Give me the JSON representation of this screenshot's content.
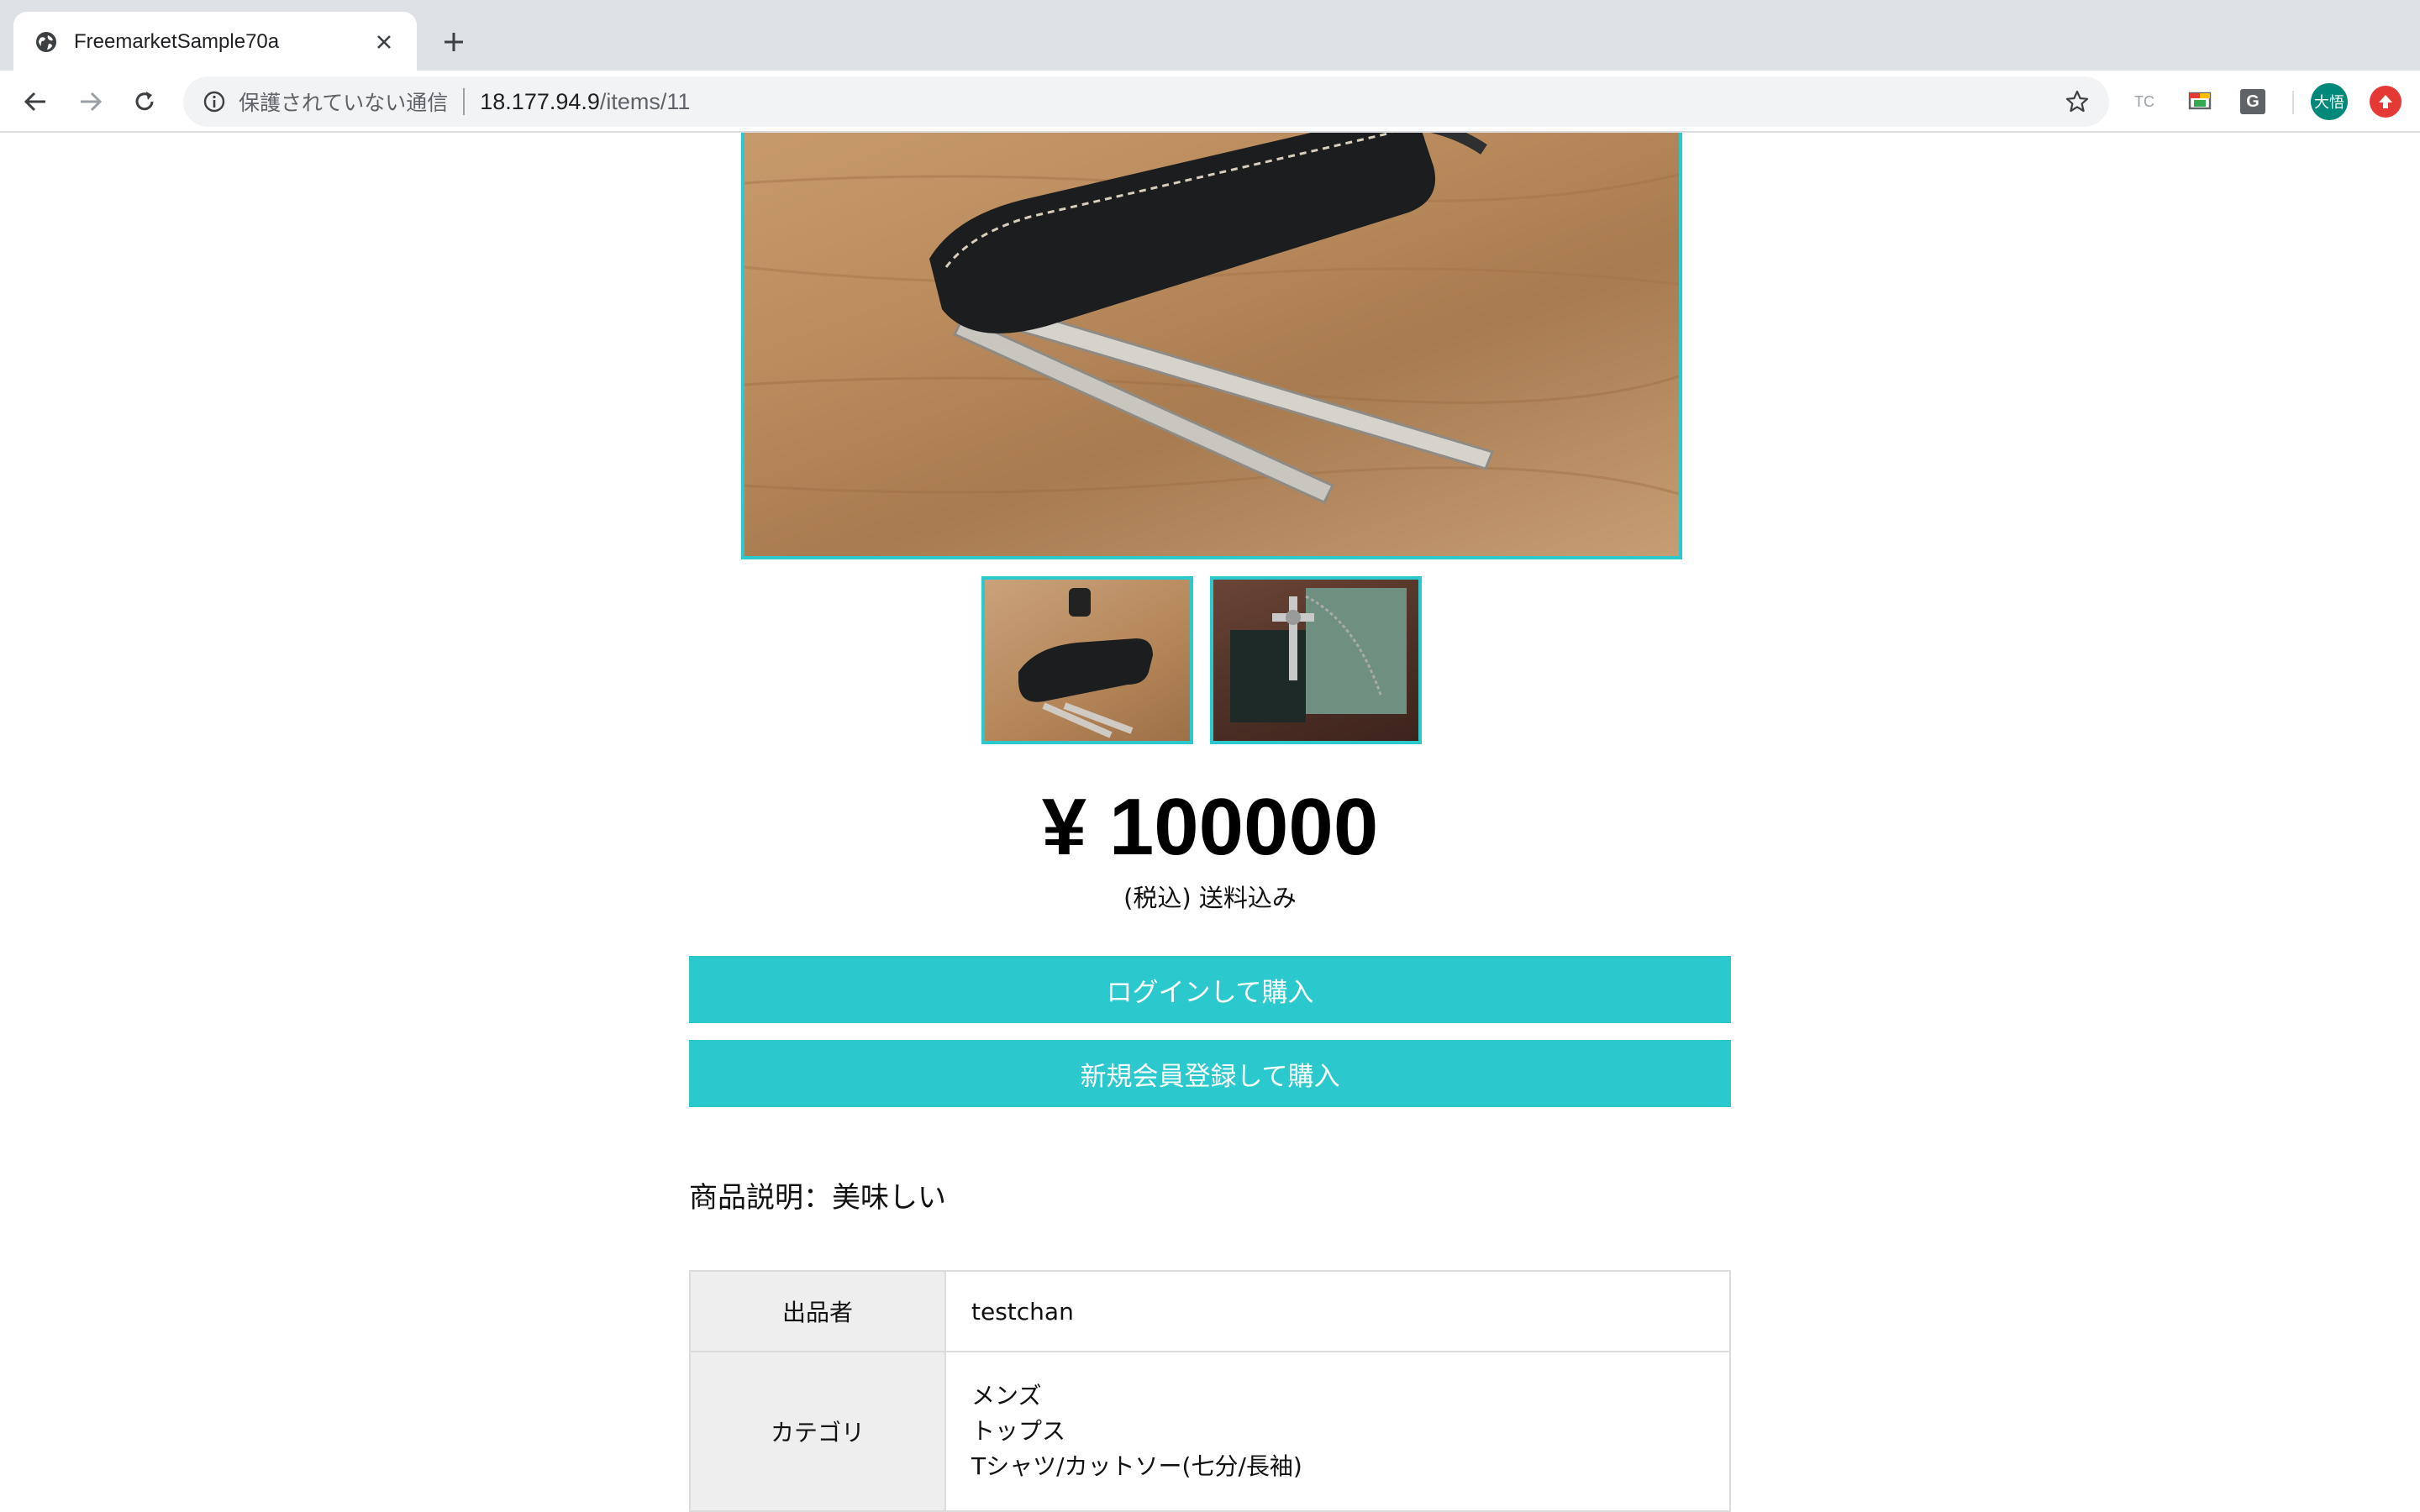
{
  "browser": {
    "tab": {
      "title": "FreemarketSample70a"
    },
    "address_bar": {
      "security_text": "保護されていない通信",
      "host": "18.177.94.9",
      "path": "/items/11"
    },
    "extensions": {
      "tc": "TC",
      "g": "G"
    },
    "profile": {
      "avatar_text": "大悟"
    }
  },
  "item": {
    "price": "¥ 100000",
    "tax_note": "(税込) 送料込み",
    "buttons": {
      "login_buy": "ログインして購入",
      "signup_buy": "新規会員登録して購入"
    },
    "description": "商品説明：美味しい",
    "details": {
      "seller_label": "出品者",
      "seller_value": "testchan",
      "category_label": "カテゴリ",
      "category_values": [
        "メンズ",
        "トップス",
        "Tシャツ/カットソー(七分/長袖)"
      ]
    }
  },
  "colors": {
    "accent": "#2bc9cd",
    "table_label_bg": "#eeeeee",
    "tabstrip_bg": "#dee1e6"
  }
}
